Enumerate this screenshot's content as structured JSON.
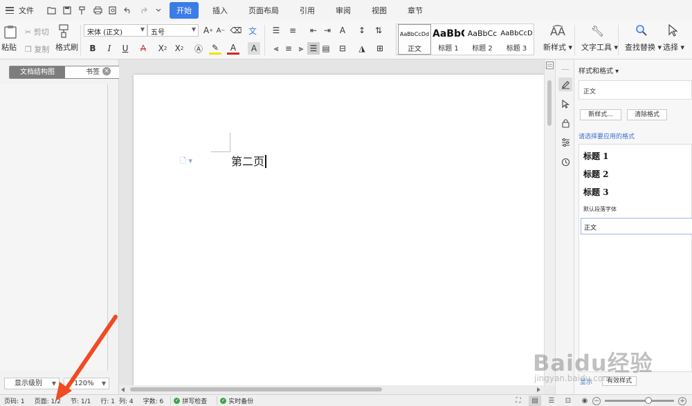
{
  "menu": {
    "file": "文件",
    "tabs": [
      "开始",
      "插入",
      "页面布局",
      "引用",
      "审阅",
      "视图",
      "章节"
    ],
    "active_tab": "开始",
    "quick_access_icons": [
      "open-folder-icon",
      "save-icon",
      "format-painter-icon",
      "print-icon",
      "print-preview-icon",
      "undo-icon",
      "redo-icon",
      "customize-icon"
    ]
  },
  "ribbon": {
    "paste": "粘贴",
    "cut": "剪切",
    "copy": "复制",
    "format_painter": "格式刷",
    "font_name": "宋体 (正文)",
    "font_size": "五号",
    "styles": [
      {
        "preview": "AaBbCcDd",
        "name": "正文"
      },
      {
        "preview": "AaBbC",
        "name": "标题 1"
      },
      {
        "preview": "AaBbCc",
        "name": "标题 2"
      },
      {
        "preview": "AaBbCcD",
        "name": "标题 3"
      }
    ],
    "new_style": "新样式",
    "text_tools": "文字工具",
    "find_replace": "查找替换",
    "select": "选择"
  },
  "left_panel": {
    "tab_outline": "文档结构图",
    "tab_bookmark": "书签",
    "level_select": "显示级别",
    "zoom_select": "120%"
  },
  "document": {
    "text": "第二页"
  },
  "styles_pane": {
    "title": "样式和格式",
    "current_style": "正文",
    "new_style_btn": "新样式...",
    "clear_format_btn": "清除格式",
    "hint": "请选择要应用的格式",
    "items": [
      "标题 1",
      "标题 2",
      "标题 3",
      "默认段落字体",
      "正文"
    ],
    "show_label": "显示",
    "show_value": "有效样式"
  },
  "status": {
    "page_no": "页码: 1",
    "pages": "页面: 1/2",
    "section": "节: 1/1",
    "row": "行: 1",
    "col": "列: 4",
    "words": "字数: 6",
    "spell": "拼写检查",
    "backup": "实时备份"
  },
  "watermark": {
    "brand": "Baidu经验",
    "url": "jingyan.baidu.com"
  },
  "colors": {
    "accent": "#3b7de8",
    "annotation_arrow": "#f04b23"
  }
}
